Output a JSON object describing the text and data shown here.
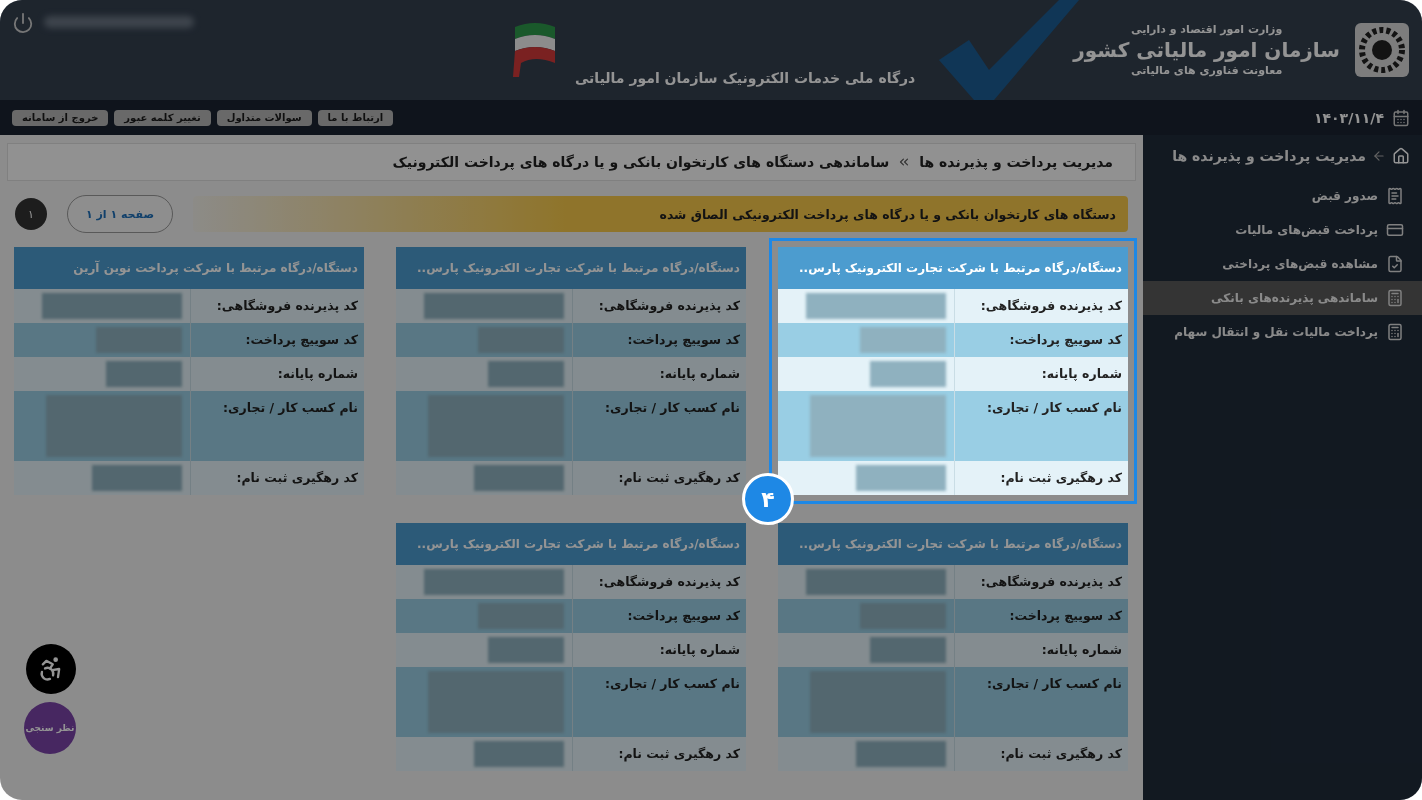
{
  "header": {
    "ministry": "وزارت امور اقتصاد و دارایی",
    "org": "سازمان امور مالیاتی کشور",
    "deputy": "معاونت فناوری های مالیاتی",
    "portal": "درگاه ملی خدمات الکترونیک سازمان امور مالیاتی",
    "user_blurred": true
  },
  "subbar": {
    "date": "۱۴۰۳/۱۱/۴",
    "buttons": [
      "ارتباط با ما",
      "سوالات متداول",
      "تغییر کلمه عبور",
      "خروج از سامانه"
    ]
  },
  "sidebar": {
    "title": "مدیریت پرداخت و پذیرنده ها",
    "items": [
      {
        "label": "صدور قبض",
        "selected": false
      },
      {
        "label": "پرداخت قبض‌های مالیات",
        "selected": false
      },
      {
        "label": "مشاهده قبض‌های پرداختی",
        "selected": false
      },
      {
        "label": "ساماندهی پذیرنده‌های بانکی",
        "selected": true
      },
      {
        "label": "پرداخت مالیات نقل و انتقال سهام",
        "selected": false
      }
    ]
  },
  "breadcrumb": [
    "مدیریت پرداخت و پذیرنده ها",
    "ساماندهی دستگاه های کارتخوان بانکی و یا درگاه های پرداخت الکترونیک"
  ],
  "alert": "دستگاه های کارتخوان بانکی و یا درگاه های پرداخت الکترونیکی الصاق شده",
  "pager": {
    "summary": "صفحه ۱ از ۱",
    "pages": [
      {
        "label": "۱",
        "selected": true
      }
    ]
  },
  "cards": [
    {
      "title": "دستگاه/درگاه مرتبط با شرکت تجارت الکترونیک پارس..",
      "highlighted": true,
      "badge": "۴",
      "fields": [
        {
          "label": "کد پذیرنده فروشگاهی:",
          "blurred": true
        },
        {
          "label": "کد سوییچ پرداخت:",
          "blurred": true
        },
        {
          "label": "شماره پایانه:",
          "blurred": true
        },
        {
          "label": "نام کسب کار / تجاری:",
          "blurred": true
        },
        {
          "label": "کد رهگیری ثبت نام:",
          "blurred": true
        }
      ]
    },
    {
      "title": "دستگاه/درگاه مرتبط با شرکت تجارت الکترونیک پارس..",
      "highlighted": false,
      "fields": [
        {
          "label": "کد پذیرنده فروشگاهی:",
          "blurred": true
        },
        {
          "label": "کد سوییچ پرداخت:",
          "blurred": true
        },
        {
          "label": "شماره پایانه:",
          "blurred": true
        },
        {
          "label": "نام کسب کار / تجاری:",
          "blurred": true
        },
        {
          "label": "کد رهگیری ثبت نام:",
          "blurred": true
        }
      ]
    },
    {
      "title": "دستگاه/درگاه مرتبط با شرکت پرداخت نوین آرین",
      "highlighted": false,
      "fields": [
        {
          "label": "کد پذیرنده فروشگاهی:",
          "blurred": true
        },
        {
          "label": "کد سوییچ پرداخت:",
          "blurred": true
        },
        {
          "label": "شماره پایانه:",
          "blurred": true
        },
        {
          "label": "نام کسب کار / تجاری:",
          "blurred": true
        },
        {
          "label": "کد رهگیری ثبت نام:",
          "blurred": true
        }
      ]
    },
    {
      "title": "دستگاه/درگاه مرتبط با شرکت تجارت الکترونیک پارس..",
      "highlighted": false,
      "fields": [
        {
          "label": "کد پذیرنده فروشگاهی:",
          "blurred": true
        },
        {
          "label": "کد سوییچ پرداخت:",
          "blurred": true
        },
        {
          "label": "شماره پایانه:",
          "blurred": true
        },
        {
          "label": "نام کسب کار / تجاری:",
          "blurred": true
        },
        {
          "label": "کد رهگیری ثبت نام:",
          "blurred": true
        }
      ]
    },
    {
      "title": "دستگاه/درگاه مرتبط با شرکت تجارت الکترونیک پارس..",
      "highlighted": false,
      "fields": [
        {
          "label": "کد پذیرنده فروشگاهی:",
          "blurred": true
        },
        {
          "label": "کد سوییچ پرداخت:",
          "blurred": true
        },
        {
          "label": "شماره پایانه:",
          "blurred": true
        },
        {
          "label": "نام کسب کار / تجاری:",
          "blurred": true
        },
        {
          "label": "کد رهگیری ثبت نام:",
          "blurred": true
        }
      ]
    }
  ],
  "floating": {
    "survey": "نظر سنجی"
  }
}
